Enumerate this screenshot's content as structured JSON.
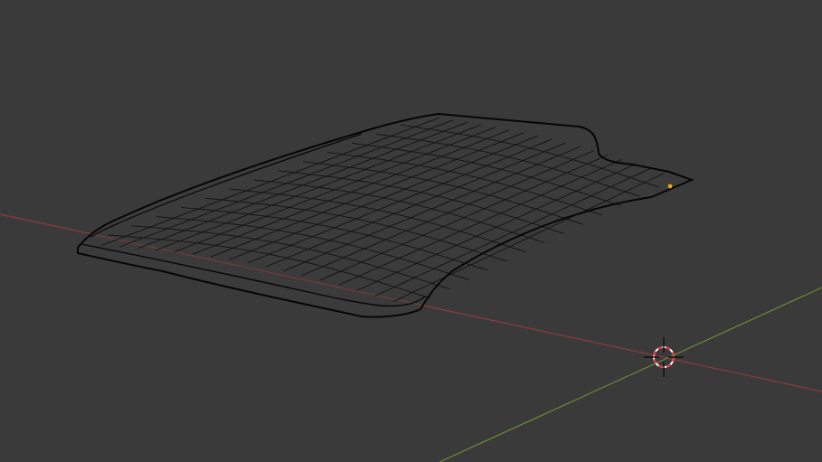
{
  "viewport": {
    "view": "3D viewport",
    "mode": "wireframe",
    "background_color": "#3a3a3a",
    "axes": {
      "x_axis_color": "#8e3a3f",
      "y_axis_color": "#6b8a35"
    },
    "object": {
      "kind": "curved roof-like mesh",
      "wire_color": "#121212",
      "outline_color": "#060606",
      "origin_color": "#f4a31c"
    },
    "cursor": {
      "icon": "3d-cursor-icon",
      "ring_color_a": "#ffffff",
      "ring_color_b": "#e4393f"
    }
  }
}
